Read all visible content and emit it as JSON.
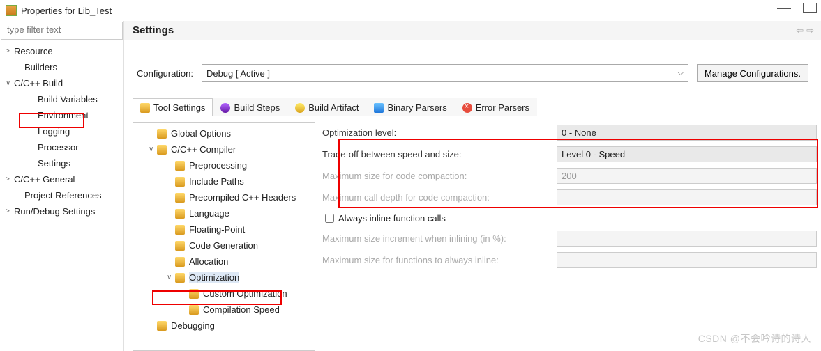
{
  "window": {
    "title": "Properties for Lib_Test"
  },
  "filter": {
    "placeholder": "type filter text"
  },
  "navtree": [
    {
      "label": "Resource",
      "level": 0,
      "arrow": "closed"
    },
    {
      "label": "Builders",
      "level": 1,
      "arrow": "none"
    },
    {
      "label": "C/C++ Build",
      "level": 0,
      "arrow": "open"
    },
    {
      "label": "Build Variables",
      "level": 2,
      "arrow": "none"
    },
    {
      "label": "Environment",
      "level": 2,
      "arrow": "none"
    },
    {
      "label": "Logging",
      "level": 2,
      "arrow": "none"
    },
    {
      "label": "Processor",
      "level": 2,
      "arrow": "none"
    },
    {
      "label": "Settings",
      "level": 2,
      "arrow": "none"
    },
    {
      "label": "C/C++ General",
      "level": 0,
      "arrow": "closed"
    },
    {
      "label": "Project References",
      "level": 1,
      "arrow": "none"
    },
    {
      "label": "Run/Debug Settings",
      "level": 0,
      "arrow": "closed"
    }
  ],
  "header": {
    "title": "Settings"
  },
  "config": {
    "label": "Configuration:",
    "value": "Debug  [ Active ]",
    "manage": "Manage Configurations."
  },
  "tabs": [
    {
      "label": "Tool Settings",
      "icon": "wrench",
      "active": true
    },
    {
      "label": "Build Steps",
      "icon": "steps"
    },
    {
      "label": "Build Artifact",
      "icon": "bulb"
    },
    {
      "label": "Binary Parsers",
      "icon": "bin"
    },
    {
      "label": "Error Parsers",
      "icon": "err"
    }
  ],
  "tooltree": [
    {
      "label": "Global Options",
      "level": 1,
      "arrow": "none"
    },
    {
      "label": "C/C++ Compiler",
      "level": 1,
      "arrow": "open"
    },
    {
      "label": "Preprocessing",
      "level": 2,
      "arrow": "none"
    },
    {
      "label": "Include Paths",
      "level": 2,
      "arrow": "none"
    },
    {
      "label": "Precompiled C++ Headers",
      "level": 2,
      "arrow": "none"
    },
    {
      "label": "Language",
      "level": 2,
      "arrow": "none"
    },
    {
      "label": "Floating-Point",
      "level": 2,
      "arrow": "none"
    },
    {
      "label": "Code Generation",
      "level": 2,
      "arrow": "none"
    },
    {
      "label": "Allocation",
      "level": 2,
      "arrow": "none"
    },
    {
      "label": "Optimization",
      "level": 2,
      "arrow": "open",
      "selected": true
    },
    {
      "label": "Custom Optimization",
      "level": 3,
      "arrow": "none"
    },
    {
      "label": "Compilation Speed",
      "level": 3,
      "arrow": "none"
    },
    {
      "label": "Debugging",
      "level": 1,
      "arrow": "none"
    }
  ],
  "form": {
    "rows": [
      {
        "label": "Optimization level:",
        "value": "0 - None",
        "type": "combo",
        "enabled": true
      },
      {
        "label": "Trade-off between speed and size:",
        "value": "Level 0 - Speed",
        "type": "combo",
        "enabled": true
      },
      {
        "label": "Maximum size for code compaction:",
        "value": "200",
        "type": "text",
        "enabled": false
      },
      {
        "label": "Maximum call depth for code compaction:",
        "value": "",
        "type": "text",
        "enabled": false
      },
      {
        "label": "Always inline function calls",
        "type": "checkbox",
        "checked": false
      },
      {
        "label": "Maximum size increment when inlining (in %):",
        "value": "",
        "type": "text",
        "enabled": false
      },
      {
        "label": "Maximum size for functions to always inline:",
        "value": "",
        "type": "text",
        "enabled": false
      }
    ]
  },
  "watermark": "CSDN @不会吟诗的诗人"
}
